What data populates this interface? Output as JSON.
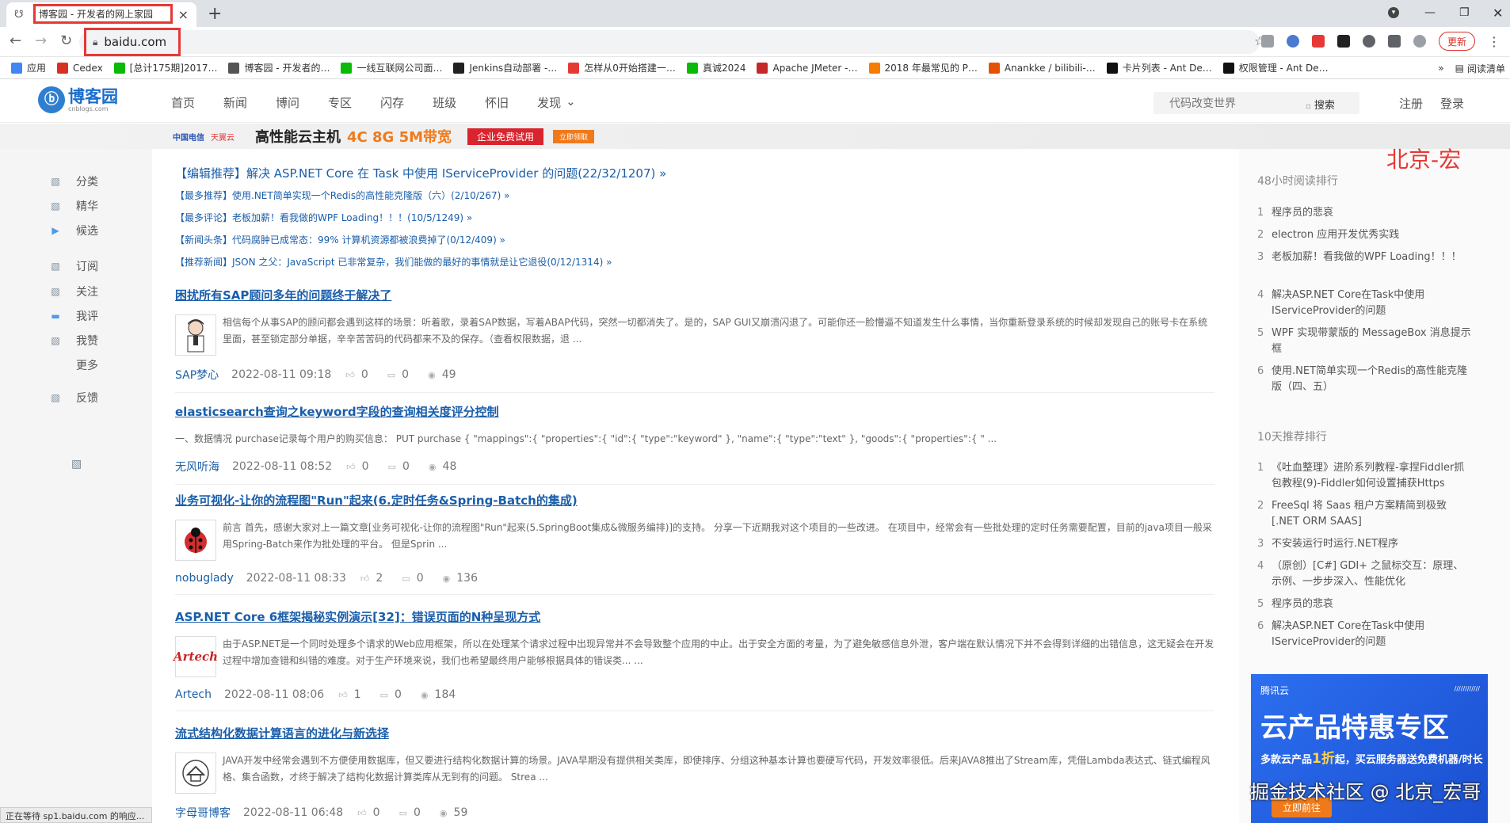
{
  "browser": {
    "tab_title": "博客园 - 开发者的网上家园",
    "url": "baidu.com",
    "update_label": "更新",
    "bookmarks": [
      {
        "label": "应用",
        "color": "#4285f4"
      },
      {
        "label": "Cedex",
        "color": "#d93025"
      },
      {
        "label": "[总计175期]2017…",
        "color": "#09bb07"
      },
      {
        "label": "博客园 - 开发者的…",
        "color": "#555555"
      },
      {
        "label": "一线互联网公司面…",
        "color": "#09bb07"
      },
      {
        "label": "Jenkins自动部署 -…",
        "color": "#222222"
      },
      {
        "label": "怎样从0开始搭建一…",
        "color": "#e53935"
      },
      {
        "label": "真诚2024",
        "color": "#09bb07"
      },
      {
        "label": "Apache JMeter -…",
        "color": "#c62828"
      },
      {
        "label": "2018 年最常见的 P…",
        "color": "#f57c00"
      },
      {
        "label": "Anankke / bilibili-…",
        "color": "#e65100"
      },
      {
        "label": "卡片列表 - Ant De…",
        "color": "#111111"
      },
      {
        "label": "权限管理 - Ant De…",
        "color": "#111111"
      }
    ],
    "more_bookmarks": "»",
    "reading_list": "阅读清单",
    "status": "正在等待 sp1.baidu.com 的响应..."
  },
  "site": {
    "logo_text": "博客园",
    "logo_sub": "cnblogs.com",
    "nav": [
      "首页",
      "新闻",
      "博问",
      "专区",
      "闪存",
      "班级",
      "怀旧",
      "发现"
    ],
    "search_placeholder": "代码改变世界",
    "search_button": "搜索",
    "register": "注册",
    "login": "登录"
  },
  "banner": {
    "brand1": "中国电信",
    "brand2": "天翼云",
    "headline": "高性能云主机",
    "spec": "4C 8G 5M带宽",
    "cta1": "企业免费试用",
    "cta2": "立即领取"
  },
  "leftbar": [
    {
      "label": "分类",
      "icon": "image-icon"
    },
    {
      "label": "精华",
      "icon": "image-icon"
    },
    {
      "label": "候选",
      "icon": "play-icon"
    },
    {
      "label": "订阅",
      "icon": "image-icon"
    },
    {
      "label": "关注",
      "icon": "image-icon"
    },
    {
      "label": "我评",
      "icon": "comment-icon"
    },
    {
      "label": "我赞",
      "icon": "image-icon"
    },
    {
      "label": "更多",
      "icon": ""
    },
    {
      "label": "反馈",
      "icon": "image-icon"
    }
  ],
  "featured": [
    "【编辑推荐】解决 ASP.NET Core 在 Task 中使用 IServiceProvider 的问题(22/32/1207) »",
    "【最多推荐】使用.NET简单实现一个Redis的高性能克隆版（六）(2/10/267) »",
    "【最多评论】老板加薪！看我做的WPF Loading！！！(10/5/1249) »",
    "【新闻头条】代码腐肿已成常态：99% 计算机资源都被浪费掉了(0/12/409) »",
    "【推荐新闻】JSON 之父：JavaScript 已非常复杂，我们能做的最好的事情就是让它退役(0/12/1314) »"
  ],
  "posts": [
    {
      "title": "困扰所有SAP顾问多年的问题终于解决了",
      "summary": "相信每个从事SAP的顾问都会遇到这样的场景：听着歌，录着SAP数据，写着ABAP代码，突然一切都消失了。是的，SAP GUI又崩溃闪退了。可能你还一脸懵逼不知道发生什么事情，当你重新登录系统的时候却发现自己的账号卡在系统里面，甚至锁定部分单据，辛辛苦苦码的代码都来不及的保存。（查看权限数据，退 ...",
      "author": "SAP梦心",
      "time": "2022-08-11 09:18",
      "likes": "0",
      "comments": "0",
      "views": "49",
      "avatar": "person-avatar"
    },
    {
      "title": "elasticsearch查询之keyword字段的查询相关度评分控制",
      "summary": "一、数据情况 purchase记录每个用户的购买信息： PUT purchase { \"mappings\":{ \"properties\":{ \"id\":{ \"type\":\"keyword\" }, \"name\":{ \"type\":\"text\" }, \"goods\":{ \"properties\":{ \" ...",
      "author": "无风听海",
      "time": "2022-08-11 08:52",
      "likes": "0",
      "comments": "0",
      "views": "48",
      "avatar": ""
    },
    {
      "title": "业务可视化-让你的流程图\"Run\"起来(6.定时任务&Spring-Batch的集成)",
      "summary": "前言 首先，感谢大家对上一篇文章[业务可视化-让你的流程图\"Run\"起来(5.SpringBoot集成&微服务编排)]的支持。 分享一下近期我对这个项目的一些改进。 在项目中，经常会有一些批处理的定时任务需要配置，目前的java项目一般采用Spring-Batch来作为批处理的平台。 但是Sprin ...",
      "author": "nobuglady",
      "time": "2022-08-11 08:33",
      "likes": "2",
      "comments": "0",
      "views": "136",
      "avatar": "ladybug-avatar"
    },
    {
      "title": "ASP.NET Core 6框架揭秘实例演示[32]：错误页面的N种呈现方式",
      "summary": "由于ASP.NET是一个同时处理多个请求的Web应用框架，所以在处理某个请求过程中出现异常并不会导致整个应用的中止。出于安全方面的考量，为了避免敏感信息外泄，客户端在默认情况下并不会得到详细的出错信息，这无疑会在开发过程中增加查错和纠错的难度。对于生产环境来说，我们也希望最终用户能够根据具体的错误类... ...",
      "author": "Artech",
      "time": "2022-08-11 08:06",
      "likes": "1",
      "comments": "0",
      "views": "184",
      "avatar": "artech-avatar",
      "avatar_text": "Artech"
    },
    {
      "title": "流式结构化数据计算语言的进化与新选择",
      "summary": "JAVA开发中经常会遇到不方便使用数据库，但又要进行结构化数据计算的场景。JAVA早期没有提供相关类库，即使排序、分组这种基本计算也要硬写代码，开发效率很低。后来JAVA8推出了Stream库，凭借Lambda表达式、链式编程风格、集合函数，才终于解决了结构化数据计算类库从无到有的问题。 Strea ...",
      "author": "字母哥博客",
      "time": "2022-08-11 06:48",
      "likes": "0",
      "comments": "0",
      "views": "59",
      "avatar": "house-avatar"
    }
  ],
  "right": {
    "watermark": "北京-宏",
    "reading_rank_title": "48小时阅读排行",
    "reading_rank": [
      "程序员的悲哀",
      "electron 应用开发优秀实践",
      "老板加薪！看我做的WPF Loading！！！",
      "解决ASP.NET Core在Task中使用IServiceProvider的问题",
      "WPF 实现带蒙版的 MessageBox 消息提示框",
      "使用.NET简单实现一个Redis的高性能克隆版（四、五）"
    ],
    "recommend_title": "10天推荐排行",
    "recommend": [
      "《吐血整理》进阶系列教程-拿捏Fiddler抓包教程(9)-Fiddler如何设置捕获Https",
      "FreeSql 将 Saas 租户方案精简到极致[.NET ORM SAAS]",
      "不安装运行时运行.NET程序",
      "（原创）[C#] GDI+ 之鼠标交互：原理、示例、一步步深入、性能优化",
      "程序员的悲哀",
      "解决ASP.NET Core在Task中使用IServiceProvider的问题"
    ],
    "ad": {
      "brand": "腾讯云",
      "headline": "云产品特惠专区",
      "sub_before": "多款云产品",
      "sub_highlight": "1折",
      "sub_after": "起，买云服务器送免费机器/时长",
      "cta": "立即前往"
    },
    "bottom_watermark": "掘金技术社区 @ 北京_宏哥"
  }
}
